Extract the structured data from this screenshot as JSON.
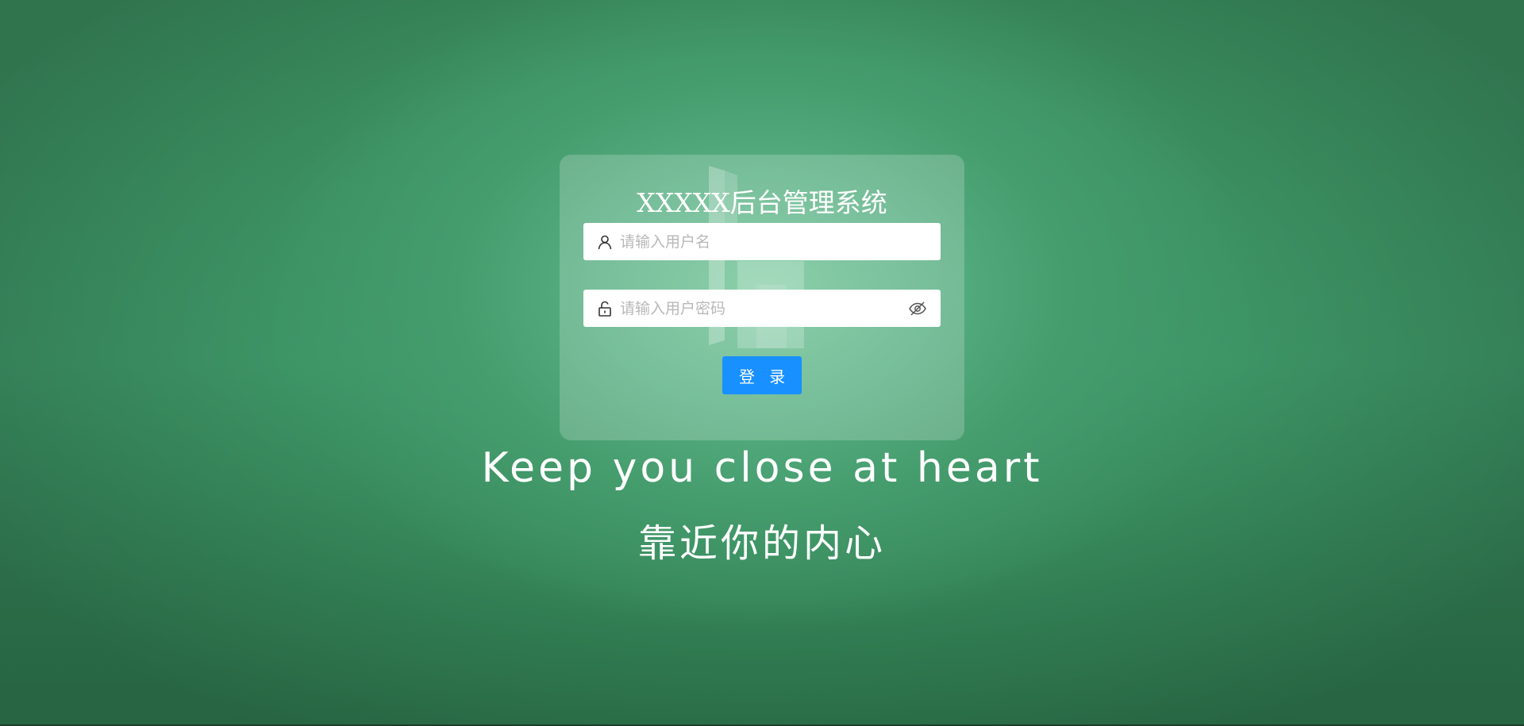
{
  "login": {
    "title": "XXXXX后台管理系统",
    "username": {
      "placeholder": "请输入用户名",
      "value": "",
      "icon": "user-icon"
    },
    "password": {
      "placeholder": "请输入用户密码",
      "value": "",
      "icon": "unlock-icon",
      "toggle_icon": "eye-off-icon"
    },
    "submit_label": "登 录"
  },
  "slogan": {
    "english": "Keep you close at heart",
    "chinese": "靠近你的内心"
  },
  "colors": {
    "background": "#3d9465",
    "card": "rgba(255,255,255,0.2)",
    "button": "#1890ff",
    "text": "#ffffff"
  }
}
